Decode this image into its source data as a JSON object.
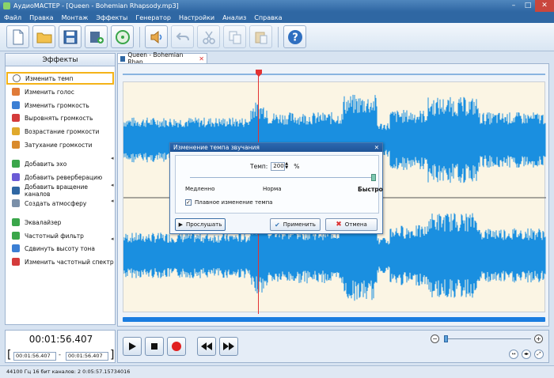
{
  "window": {
    "title": "АудиоМАСТЕР - [Queen - Bohemian Rhapsody.mp3]",
    "controls": [
      "–",
      "□",
      "✕"
    ]
  },
  "menu": [
    "Файл",
    "Правка",
    "Монтаж",
    "Эффекты",
    "Генератор",
    "Настройки",
    "Анализ",
    "Справка"
  ],
  "toolbar": {
    "buttons": [
      "new-file",
      "open-folder",
      "save-disk",
      "add-video",
      "record-cd",
      "import-audio",
      "undo",
      "cut",
      "copy",
      "paste",
      "help"
    ]
  },
  "effects": {
    "header": "Эффекты",
    "items": [
      {
        "label": "Изменить темп",
        "icon": "tempo-icon",
        "color": "#d9d9d9"
      },
      {
        "label": "Изменить голос",
        "icon": "voice-icon",
        "color": "#e07b39"
      },
      {
        "label": "Изменить громкость",
        "icon": "volume-icon",
        "color": "#3b7fd4"
      },
      {
        "label": "Выровнять громкость",
        "icon": "normalize-icon",
        "color": "#d43b3b"
      },
      {
        "label": "Возрастание громкости",
        "icon": "fade-in-icon",
        "color": "#e0a92c"
      },
      {
        "label": "Затухание громкости",
        "icon": "fade-out-icon",
        "color": "#d98a2c"
      },
      {
        "label": "Добавить эхо",
        "icon": "echo-icon",
        "color": "#3aa64a"
      },
      {
        "label": "Добавить реверберацию",
        "icon": "reverb-icon",
        "color": "#6b5bd6"
      },
      {
        "label": "Добавить вращение каналов",
        "icon": "rotate-channels-icon",
        "color": "#2f67a3"
      },
      {
        "label": "Создать атмосферу",
        "icon": "atmosphere-icon",
        "color": "#7a8fa8"
      },
      {
        "label": "Эквалайзер",
        "icon": "equalizer-icon",
        "color": "#3aa64a"
      },
      {
        "label": "Частотный фильтр",
        "icon": "filter-icon",
        "color": "#3aa64a"
      },
      {
        "label": "Сдвинуть высоту тона",
        "icon": "pitch-icon",
        "color": "#3b7fd4"
      },
      {
        "label": "Изменить частотный спектр",
        "icon": "spectrum-icon",
        "color": "#d43b3b"
      }
    ]
  },
  "tab": {
    "label": "Queen - Bohemian Rhap...",
    "close": "✕"
  },
  "dialog": {
    "title": "Изменение темпа звучания",
    "close": "✕",
    "tempo_label": "Темп:",
    "tempo_value": "200",
    "tempo_unit": "%",
    "tempo_level": 1.0,
    "slow_label": "Медленно",
    "normal_label": "Норма",
    "fast_label": "Быстро",
    "smooth_label": "Плавное изменение темпа",
    "smooth_checked": "✓",
    "play_label": "Прослушать",
    "apply_label": "Применить",
    "cancel_label": "Отмена"
  },
  "time": {
    "current": "00:01:56.407",
    "start": "00:01:56.407",
    "end": "00:01:56.407",
    "dash": "-",
    "bracket_left": "[",
    "bracket_right": "]"
  },
  "zoom": {
    "minus": "−",
    "plus": "+"
  },
  "status": "44100 Гц  16 бит  каналов: 2  0:05:57.15734016",
  "colors": {
    "waveform": "#1a8fe0",
    "cursor": "#e33333",
    "waveform_bg": "#fbf5e4",
    "highlight": "#f4b318"
  }
}
